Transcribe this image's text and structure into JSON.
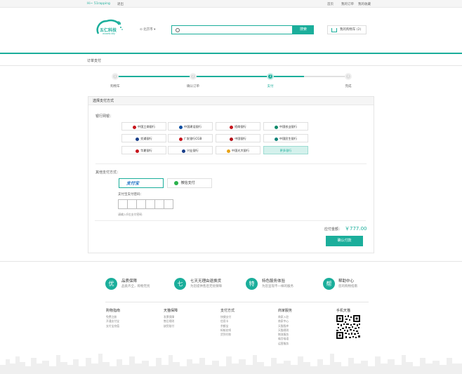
{
  "topbar": {
    "welcome": "Hi~ 51rapping",
    "logout": "退出",
    "links": [
      "首页",
      "我的订单",
      "我的收藏"
    ]
  },
  "header": {
    "logo_text": "五仁科技",
    "logo_sub": "WUREN KEJI",
    "location": "北京市",
    "search_placeholder": "",
    "search_button": "搜索",
    "cart_label": "我的购物车 (2)"
  },
  "breadcrumb": "订单支付",
  "steps": [
    {
      "number": "1",
      "label": "购物车",
      "state": "done"
    },
    {
      "number": "2",
      "label": "确认订单",
      "state": "done"
    },
    {
      "number": "3",
      "label": "支付",
      "state": "active"
    },
    {
      "number": "4",
      "label": "完成",
      "state": "todo"
    }
  ],
  "payment": {
    "panel_title": "选择支付方式",
    "bank_title": "银行网银：",
    "banks": [
      {
        "name": "中国工商银行",
        "color": "#c7161d"
      },
      {
        "name": "中国建设银行",
        "color": "#0a4ea2"
      },
      {
        "name": "招商银行",
        "color": "#c7161d"
      },
      {
        "name": "中国农业银行",
        "color": "#0e8a6b"
      },
      {
        "name": "交通银行",
        "color": "#1a3f8a"
      },
      {
        "name": "广发银行CGB",
        "color": "#c7161d"
      },
      {
        "name": "中国银行",
        "color": "#b5121b"
      },
      {
        "name": "中国民生银行",
        "color": "#11847a"
      },
      {
        "name": "华夏银行",
        "color": "#c7161d"
      },
      {
        "name": "兴业银行",
        "color": "#1a3f8a"
      },
      {
        "name": "中国光大银行",
        "color": "#e8a317"
      },
      {
        "name": "更多银行",
        "color": "#1bae9b"
      }
    ],
    "other_title": "其他支付方式：",
    "options": [
      {
        "name": "支付宝",
        "color": "#1a6fc4"
      },
      {
        "name": "微信支付",
        "color": "#2bb24c"
      }
    ],
    "password_label": "支付宝支付密码：",
    "password_hint": "请输入6位支付密码",
    "total_label": "应付金额：",
    "total_amount": "￥777.00",
    "confirm_button": "确认付款"
  },
  "services": [
    {
      "icon": "优",
      "title": "品质保障",
      "sub": "品类齐全，购物无忧"
    },
    {
      "icon": "七",
      "title": "七天无理由退换货",
      "sub": "为您提供售后无忧保障"
    },
    {
      "icon": "特",
      "title": "特色服务体验",
      "sub": "为您呈现不一样的服务"
    },
    {
      "icon": "帮",
      "title": "帮助中心",
      "sub": "您的购物指南"
    }
  ],
  "footer": [
    {
      "heading": "购物指南",
      "items": [
        "免费注册",
        "开通支付宝",
        "支付宝充值"
      ]
    },
    {
      "heading": "天猫保障",
      "items": [
        "发票保障",
        "售后规则",
        "缺货赔付"
      ]
    },
    {
      "heading": "支付方式",
      "items": [
        "快捷支付",
        "信用卡",
        "余额宝",
        "蚂蚁花呗",
        "货到付款"
      ]
    },
    {
      "heading": "商家服务",
      "items": [
        "商家入驻",
        "商家中心",
        "天猫智库",
        "天猫规则",
        "物流服务",
        "喵言喵语",
        "运营服务"
      ]
    },
    {
      "heading": "手机天猫",
      "items": []
    }
  ]
}
